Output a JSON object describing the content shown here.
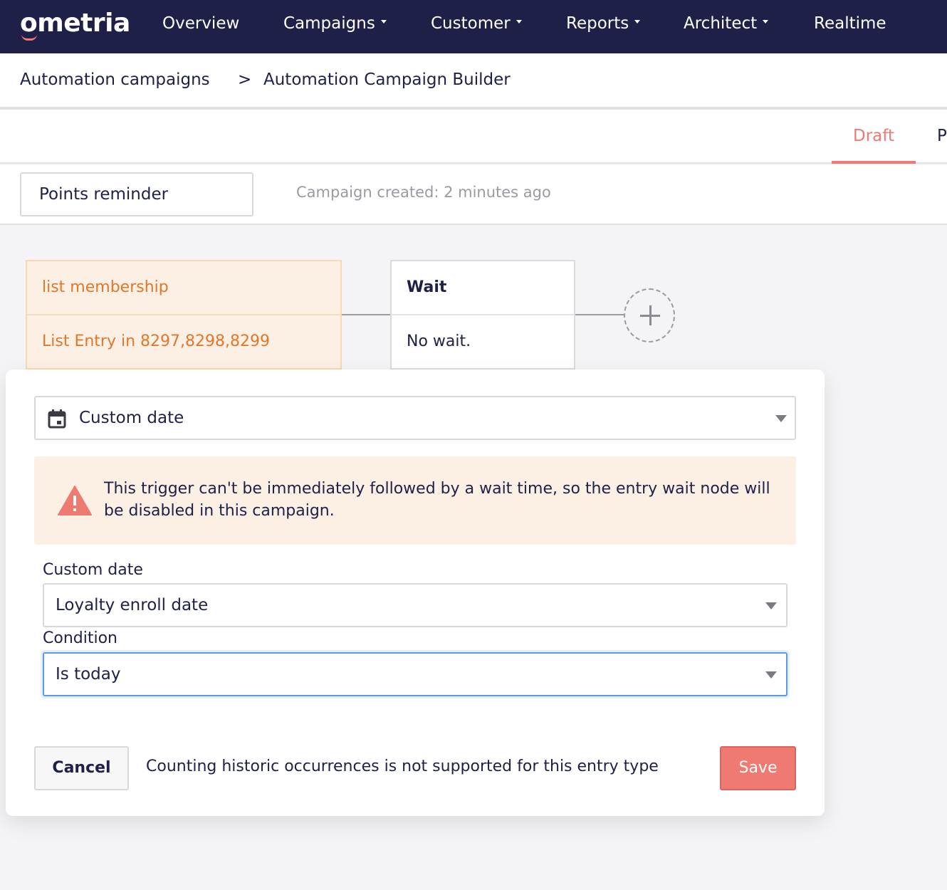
{
  "brand": {
    "logo_text": "ometria",
    "colors": {
      "nav_bg": "#1e2048",
      "accent": "#ef7a72",
      "trigger_text": "#e0782a",
      "trigger_bg": "#fcf0e4",
      "focus": "#5a9ae8"
    }
  },
  "nav": {
    "items": [
      {
        "label": "Overview",
        "has_caret": false
      },
      {
        "label": "Campaigns",
        "has_caret": true
      },
      {
        "label": "Customer",
        "has_caret": true
      },
      {
        "label": "Reports",
        "has_caret": true
      },
      {
        "label": "Architect",
        "has_caret": true
      },
      {
        "label": "Realtime",
        "has_caret": false
      }
    ]
  },
  "breadcrumb": {
    "items": [
      "Automation campaigns",
      "Automation Campaign Builder"
    ],
    "separator": ">"
  },
  "tabs": {
    "active": "Draft",
    "next_partial": "P"
  },
  "campaign": {
    "name": "Points reminder",
    "created_text": "Campaign created: 2 minutes ago"
  },
  "canvas": {
    "trigger_node": {
      "title": "list membership",
      "detail": "List Entry in 8297,8298,8299"
    },
    "wait_node": {
      "title": "Wait",
      "detail": "No wait."
    },
    "add_node_icon": "plus-icon"
  },
  "panel": {
    "trigger_type": {
      "value": "Custom date",
      "icon": "calendar-icon"
    },
    "warning": {
      "icon": "warning-triangle-icon",
      "text": "This trigger can't be immediately followed by a wait time, so the entry wait node will be disabled in this campaign."
    },
    "custom_date": {
      "label": "Custom date",
      "value": "Loyalty enroll date"
    },
    "condition": {
      "label": "Condition",
      "value": "Is today"
    },
    "cancel_label": "Cancel",
    "footer_note": "Counting historic occurrences is not supported for this entry type",
    "save_label": "Save"
  }
}
